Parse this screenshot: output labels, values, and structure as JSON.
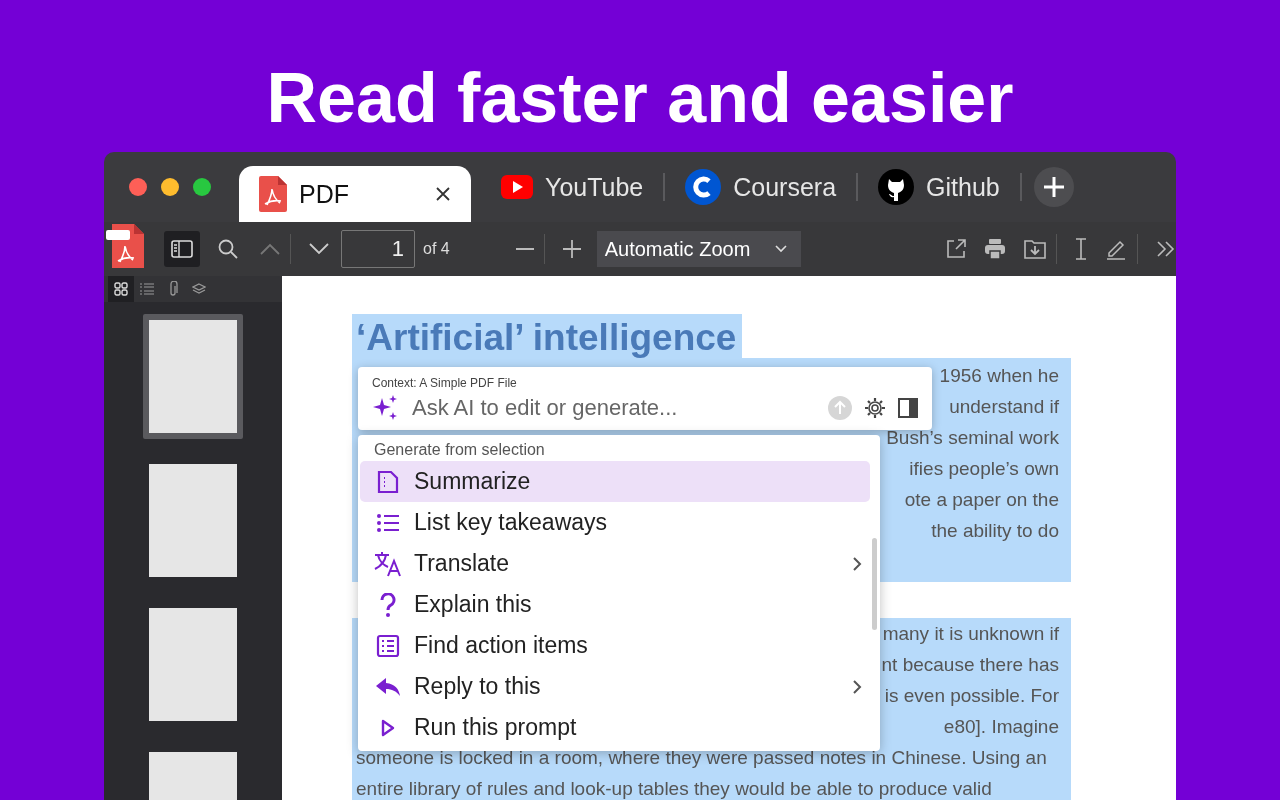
{
  "headline": "Read faster and easier",
  "tabs": [
    {
      "label": "PDF",
      "kind": "pdf",
      "selected": true
    },
    {
      "label": "YouTube",
      "kind": "video",
      "selected": false
    },
    {
      "label": "Coursera",
      "kind": "course",
      "selected": false
    },
    {
      "label": "Github",
      "kind": "code",
      "selected": false
    }
  ],
  "toolbar": {
    "page": "1",
    "page_count": "of 4",
    "zoom": "Automatic Zoom"
  },
  "sidebar": {
    "tabs": [
      {
        "kind": "grid",
        "selected": true
      },
      {
        "kind": "list",
        "selected": false
      },
      {
        "kind": "paperclip",
        "selected": false
      },
      {
        "kind": "layers",
        "selected": false
      }
    ],
    "thumbnails": [
      {
        "selected": true
      },
      {
        "selected": false
      },
      {
        "selected": false
      },
      {
        "selected": false
      }
    ]
  },
  "document": {
    "heading": "‘Artificial’ intelligence",
    "paragraphs": [
      {
        "fragments": [
          "1956 when he",
          "understand if",
          "Bush’s seminal work",
          "ifies people’s own",
          "ote a paper on the",
          "the ability to do"
        ]
      },
      {
        "fragments": [
          "many it is unknown if",
          "nt because there has",
          "is even possible. For",
          "e80]. Imagine"
        ],
        "lines": [
          "someone is locked in a room, where they were passed notes in Chinese. Using an",
          "entire library of rules and look-up tables they would be able to produce valid"
        ]
      }
    ]
  },
  "ai_prompt": {
    "context": "Context: A Simple PDF File",
    "placeholder": "Ask AI to edit or generate..."
  },
  "menu": {
    "section": "Generate from selection",
    "items": [
      {
        "label": "Summarize",
        "kind": "summarize",
        "selected": true,
        "submenu": false
      },
      {
        "label": "List key takeaways",
        "kind": "list",
        "selected": false,
        "submenu": false
      },
      {
        "label": "Translate",
        "kind": "translate",
        "selected": false,
        "submenu": true
      },
      {
        "label": "Explain this",
        "kind": "question",
        "selected": false,
        "submenu": false
      },
      {
        "label": "Find action items",
        "kind": "checklist",
        "selected": false,
        "submenu": false
      },
      {
        "label": "Reply to this",
        "kind": "reply",
        "selected": false,
        "submenu": true
      },
      {
        "label": "Run this prompt",
        "kind": "run",
        "selected": false,
        "submenu": false
      }
    ]
  }
}
